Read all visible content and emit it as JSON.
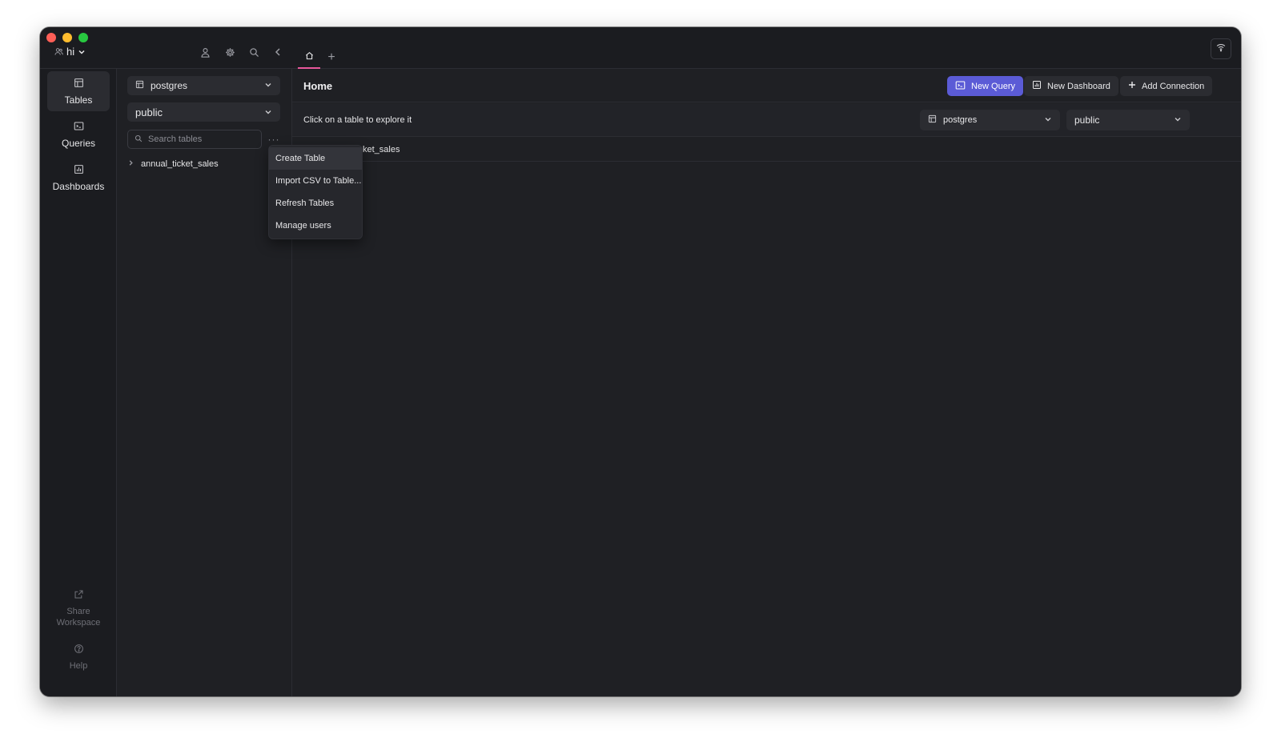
{
  "titlebar": {
    "user_label": "hi",
    "tabs": [
      {
        "icon": "home-icon"
      }
    ],
    "add_tab_label": "+"
  },
  "leftnav": {
    "items": [
      {
        "label": "Tables",
        "icon": "table-icon",
        "active": true
      },
      {
        "label": "Queries",
        "icon": "terminal-icon",
        "active": false
      },
      {
        "label": "Dashboards",
        "icon": "chart-icon",
        "active": false
      }
    ],
    "share_label": "Share Workspace",
    "help_label": "Help"
  },
  "sidebar": {
    "connection_select": "postgres",
    "schema_select": "public",
    "search_placeholder": "Search tables",
    "more_label": "···",
    "tables": [
      {
        "name": "annual_ticket_sales"
      }
    ]
  },
  "main": {
    "title": "Home",
    "buttons": {
      "new_query": "New Query",
      "new_dashboard": "New Dashboard",
      "add_connection": "Add Connection"
    },
    "hint": "Click on a table to explore it",
    "connection_select": "postgres",
    "schema_select": "public",
    "table_row_visible_text": "ket_sales"
  },
  "context_menu": {
    "items": [
      "Create Table",
      "Import CSV to Table...",
      "Refresh Tables",
      "Manage users"
    ]
  },
  "colors": {
    "accent": "#5b5bd6",
    "tab_indicator": "#e8589b",
    "background": "#1f2024"
  }
}
